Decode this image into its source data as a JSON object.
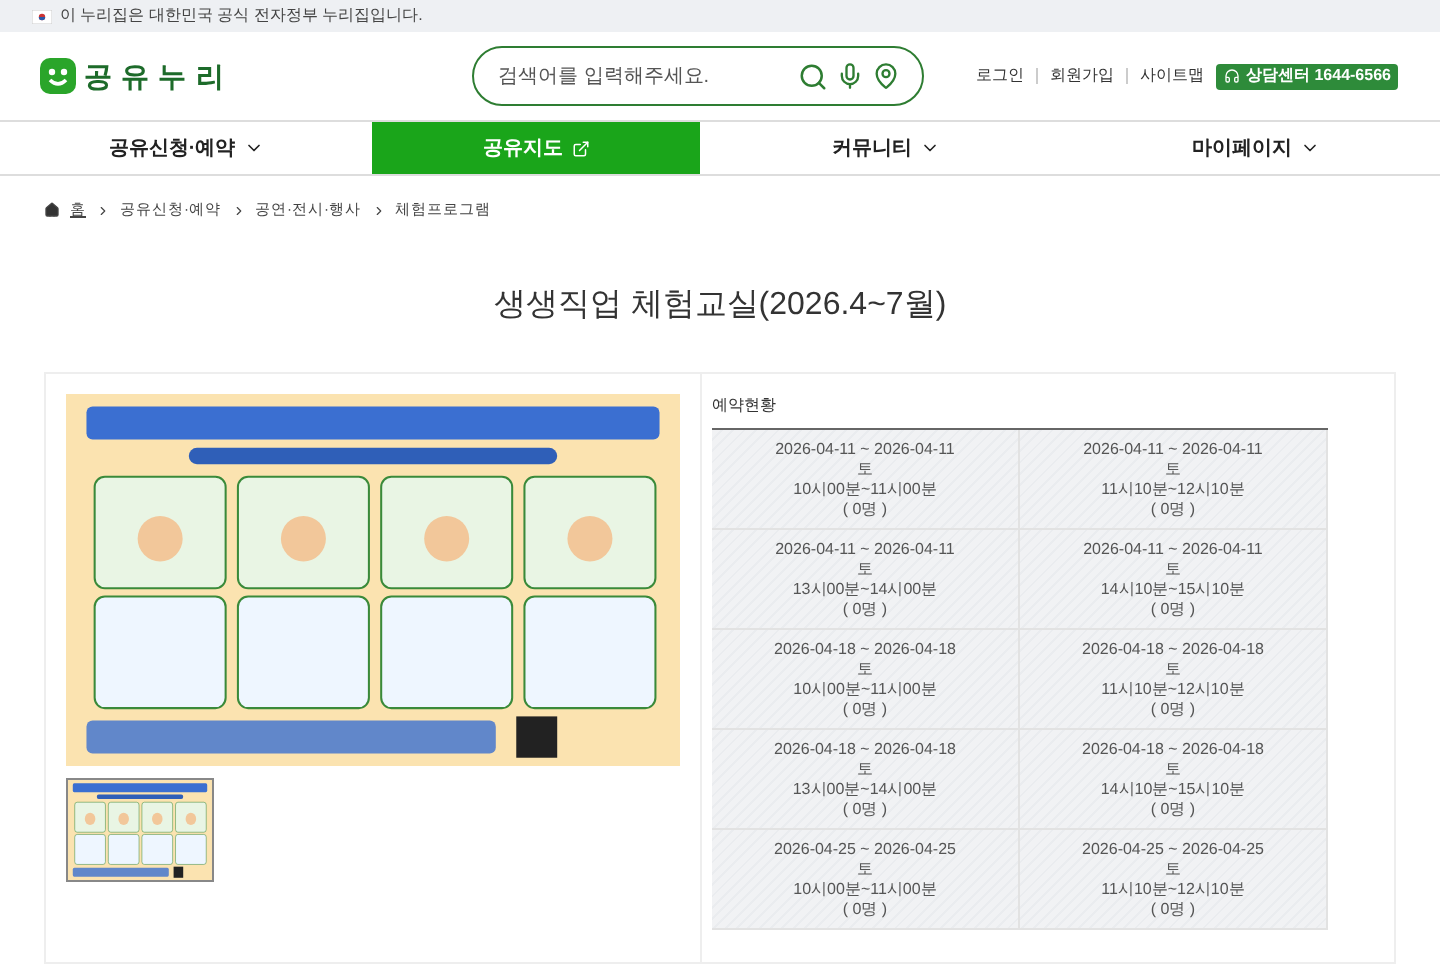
{
  "gov_banner": {
    "text": "이 누리집은 대한민국 공식 전자정부 누리집입니다."
  },
  "header": {
    "logo": "공 유 누 리",
    "search": {
      "placeholder": "검색어를 입력해주세요."
    },
    "links": [
      "로그인",
      "회원가입",
      "사이트맵"
    ],
    "call_center": "상담센터 1644-6566"
  },
  "nav": [
    {
      "label": "공유신청·예약",
      "selected": false,
      "kind": "dropdown"
    },
    {
      "label": "공유지도",
      "selected": true,
      "kind": "external"
    },
    {
      "label": "커뮤니티",
      "selected": false,
      "kind": "dropdown"
    },
    {
      "label": "마이페이지",
      "selected": false,
      "kind": "dropdown"
    }
  ],
  "breadcrumb": [
    "홈",
    "공유신청·예약",
    "공연·전시·행사",
    "체험프로그램"
  ],
  "page_title": "생생직업 체험교실(2026.4~7월)",
  "gallery": {
    "main": {
      "kind": "picture"
    },
    "thumbnails": [
      {
        "kind": "picture",
        "selected": true
      }
    ]
  },
  "reservation": {
    "title": "예약현황",
    "slots": [
      {
        "date": "2026-04-11 ~ 2026-04-11",
        "day": "토",
        "time": "10시00분~11시00분",
        "count": "( 0명 )",
        "disabled": true
      },
      {
        "date": "2026-04-11 ~ 2026-04-11",
        "day": "토",
        "time": "11시10분~12시10분",
        "count": "( 0명 )",
        "disabled": true
      },
      {
        "date": "2026-04-11 ~ 2026-04-11",
        "day": "토",
        "time": "13시00분~14시00분",
        "count": "( 0명 )",
        "disabled": true
      },
      {
        "date": "2026-04-11 ~ 2026-04-11",
        "day": "토",
        "time": "14시10분~15시10분",
        "count": "( 0명 )",
        "disabled": true
      },
      {
        "date": "2026-04-18 ~ 2026-04-18",
        "day": "토",
        "time": "10시00분~11시00분",
        "count": "( 0명 )",
        "disabled": true
      },
      {
        "date": "2026-04-18 ~ 2026-04-18",
        "day": "토",
        "time": "11시10분~12시10분",
        "count": "( 0명 )",
        "disabled": true
      },
      {
        "date": "2026-04-18 ~ 2026-04-18",
        "day": "토",
        "time": "13시00분~14시00분",
        "count": "( 0명 )",
        "disabled": true
      },
      {
        "date": "2026-04-18 ~ 2026-04-18",
        "day": "토",
        "time": "14시10분~15시10분",
        "count": "( 0명 )",
        "disabled": true
      },
      {
        "date": "2026-04-25 ~ 2026-04-25",
        "day": "토",
        "time": "10시00분~11시00분",
        "count": "( 0명 )",
        "disabled": true
      },
      {
        "date": "2026-04-25 ~ 2026-04-25",
        "day": "토",
        "time": "11시10분~12시10분",
        "count": "( 0명 )",
        "disabled": true
      }
    ]
  }
}
